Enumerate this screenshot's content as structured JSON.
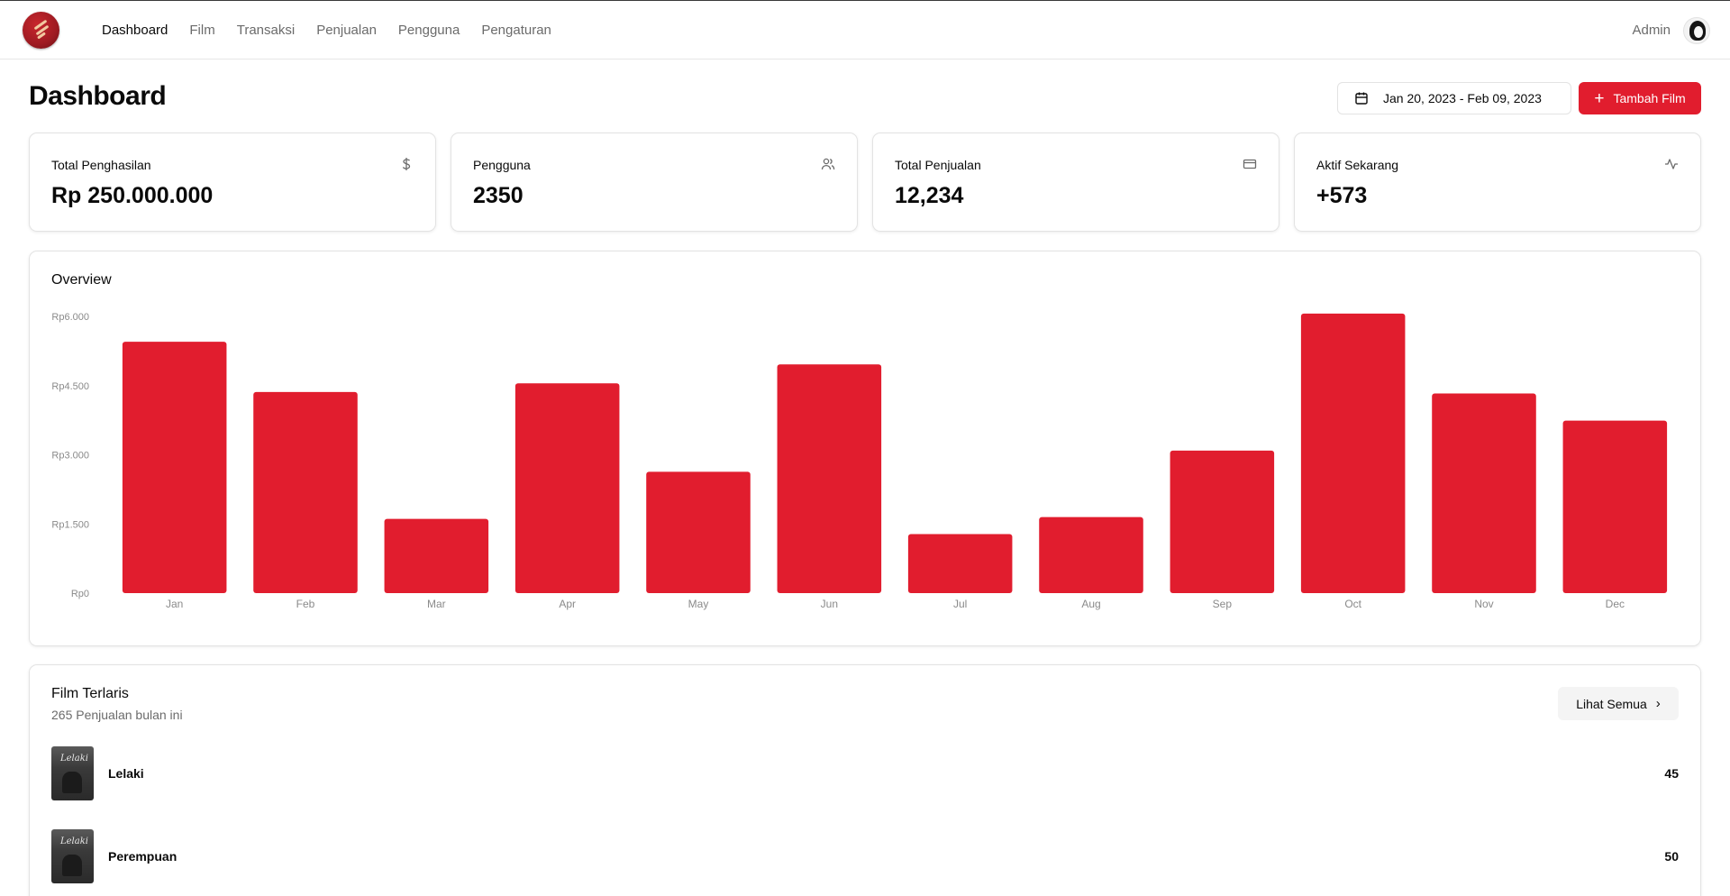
{
  "nav": {
    "items": [
      {
        "label": "Dashboard",
        "active": true
      },
      {
        "label": "Film",
        "active": false
      },
      {
        "label": "Transaksi",
        "active": false
      },
      {
        "label": "Penjualan",
        "active": false
      },
      {
        "label": "Pengguna",
        "active": false
      },
      {
        "label": "Pengaturan",
        "active": false
      }
    ],
    "user_name": "Admin"
  },
  "header": {
    "title": "Dashboard",
    "date_range": "Jan 20, 2023 - Feb 09, 2023",
    "add_button": "Tambah Film"
  },
  "stats": [
    {
      "label": "Total Penghasilan",
      "value": "Rp 250.000.000",
      "icon": "dollar-icon"
    },
    {
      "label": "Pengguna",
      "value": "2350",
      "icon": "users-icon"
    },
    {
      "label": "Total Penjualan",
      "value": "12,234",
      "icon": "credit-card-icon"
    },
    {
      "label": "Aktif Sekarang",
      "value": "+573",
      "icon": "activity-icon"
    }
  ],
  "overview": {
    "title": "Overview"
  },
  "chart_data": {
    "type": "bar",
    "title": "Overview",
    "categories": [
      "Jan",
      "Feb",
      "Mar",
      "Apr",
      "May",
      "Jun",
      "Jul",
      "Aug",
      "Sep",
      "Oct",
      "Nov",
      "Dec"
    ],
    "values": [
      5450,
      4360,
      1610,
      4550,
      2630,
      4960,
      1280,
      1650,
      3090,
      6060,
      4330,
      3740
    ],
    "yticks": [
      "Rp0",
      "Rp1.500",
      "Rp3.000",
      "Rp4.500",
      "Rp6.000"
    ],
    "ylim": [
      0,
      6000
    ],
    "color": "#e11d2e",
    "grid": false,
    "xlabel": "",
    "ylabel": ""
  },
  "films": {
    "title": "Film Terlaris",
    "subtitle": "265 Penjualan bulan ini",
    "see_all": "Lihat Semua",
    "items": [
      {
        "name": "Lelaki",
        "count": "45",
        "poster_text": "Lelaki"
      },
      {
        "name": "Perempuan",
        "count": "50",
        "poster_text": "Lelaki"
      }
    ]
  },
  "colors": {
    "accent": "#e11d2e",
    "text": "#0a0a0a",
    "muted": "#6b6b6b",
    "border": "#e3e3e3"
  }
}
